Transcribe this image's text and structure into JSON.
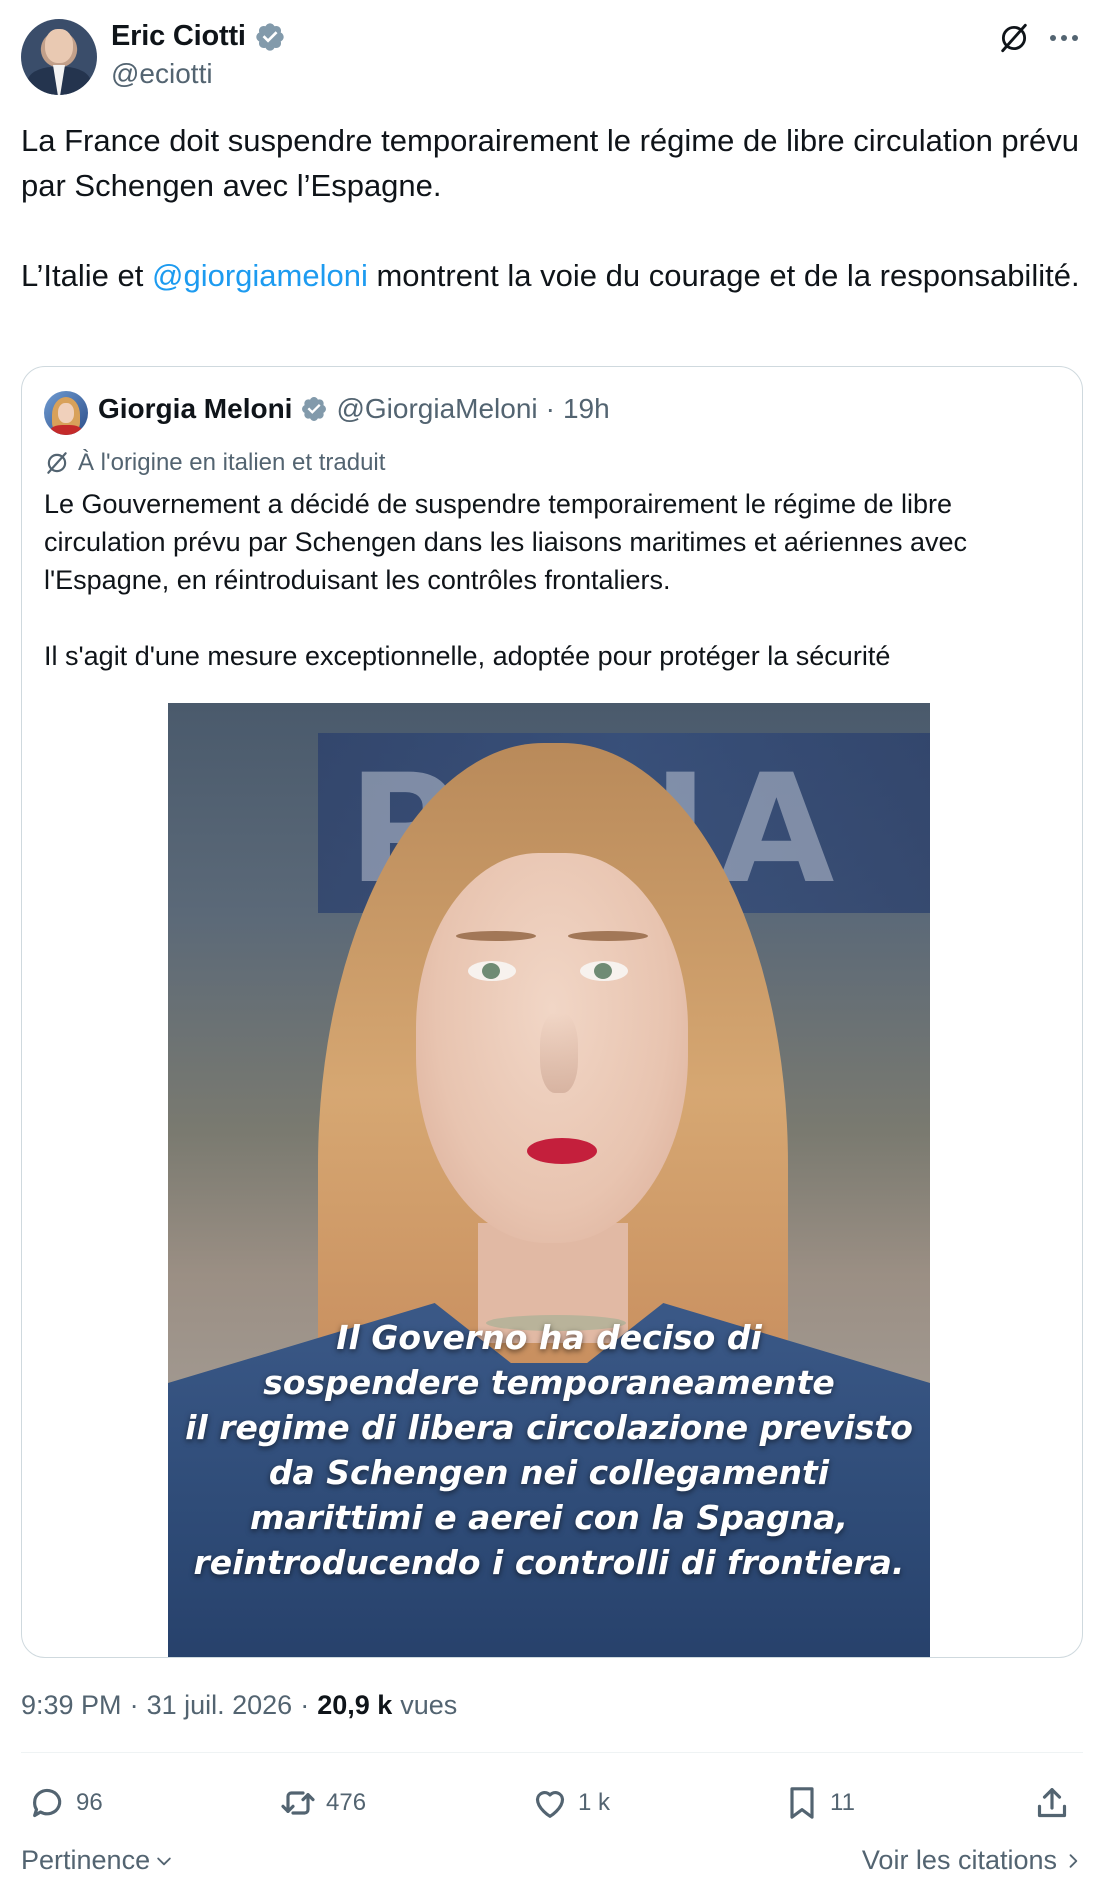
{
  "tweet": {
    "author": {
      "name": "Eric Ciotti",
      "handle": "@eciotti",
      "verified_icon": "verified-badge-icon"
    },
    "text_lines": {
      "p1": "La France doit suspendre temporairement le régime de libre circulation prévu par Schengen avec l’Espagne.",
      "p2_before": "L’Italie et ",
      "p2_mention": "@giorgiameloni",
      "p2_after": " montrent la voie du courage et de la responsabilité."
    },
    "quote": {
      "name": "Giorgia Meloni",
      "handle": "@GiorgiaMeloni",
      "dot": "·",
      "time": "19h",
      "translated_label": "À l'origine en italien et traduit",
      "text_p1": "Le Gouvernement a décidé de suspendre temporairement le régime de libre circulation prévu par Schengen dans les liaisons maritimes et aériennes avec l'Espagne, en réintroduisant les contrôles frontaliers.",
      "text_p2": "Il s'agit d'une mesure exceptionnelle, adoptée pour protéger la sécurité",
      "image_caption": "Il Governo ha deciso di\nsospendere temporaneamente\nil regime di libera circolazione previsto\nda Schengen nei collegamenti\nmarittimi e aerei con la Spagna,\nreintroducendo i controlli di frontiera."
    },
    "meta": {
      "time": "9:39 PM",
      "sep1": "·",
      "date": "31 juil. 2026",
      "sep2": "·",
      "views_count": "20,9 k",
      "views_label": "vues"
    },
    "actions": {
      "replies": "96",
      "reposts": "476",
      "likes": "1 k",
      "bookmarks": "11"
    },
    "footer": {
      "sort_label": "Pertinence",
      "quotes_link": "Voir les citations"
    },
    "colors": {
      "accent": "#1d9bf0",
      "text": "#0f1419",
      "secondary": "#536471",
      "border": "#cfd9de"
    }
  }
}
